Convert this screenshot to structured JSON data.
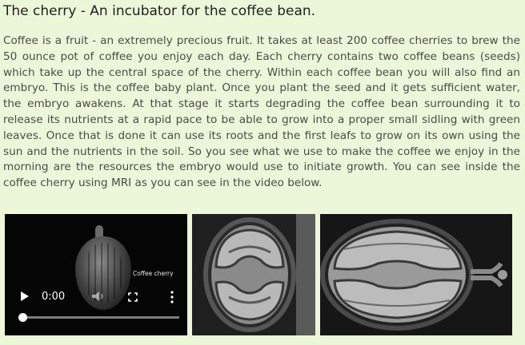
{
  "article": {
    "title": "The cherry - An incubator for the coffee bean.",
    "body": "Coffee is a fruit - an extremely precious fruit. It takes at least 200 coffee cherries to brew the 50 ounce pot of coffee you enjoy each day. Each cherry contains two coffee beans (seeds) which take up the central space of the cherry. Within each coffee bean you will also find an embryo. This is the coffee baby plant. Once you plant the seed and it gets sufficient water, the embryo awakens. At that stage it starts degrading the coffee bean surrounding it to release its nutrients at a rapid pace to be able to grow into a proper small sidling with green leaves. Once that is done it can use its roots and the first leafs to grow on its own using the sun and the nutrients in the soil. So you see what we use to make the coffee we enjoy in the morning are the resources the embryo would use to initiate growth. You can see inside the coffee cherry using MRI as you can see in the video below."
  },
  "video": {
    "overlay_label": "Coffee cherry",
    "time": "0:00",
    "progress": 0,
    "icons": [
      "play-icon",
      "volume-icon",
      "fullscreen-icon",
      "more-options-icon"
    ]
  },
  "images": [
    "mri-coffee-cherry-cross-section",
    "mri-coffee-cherry-longitudinal-section"
  ]
}
